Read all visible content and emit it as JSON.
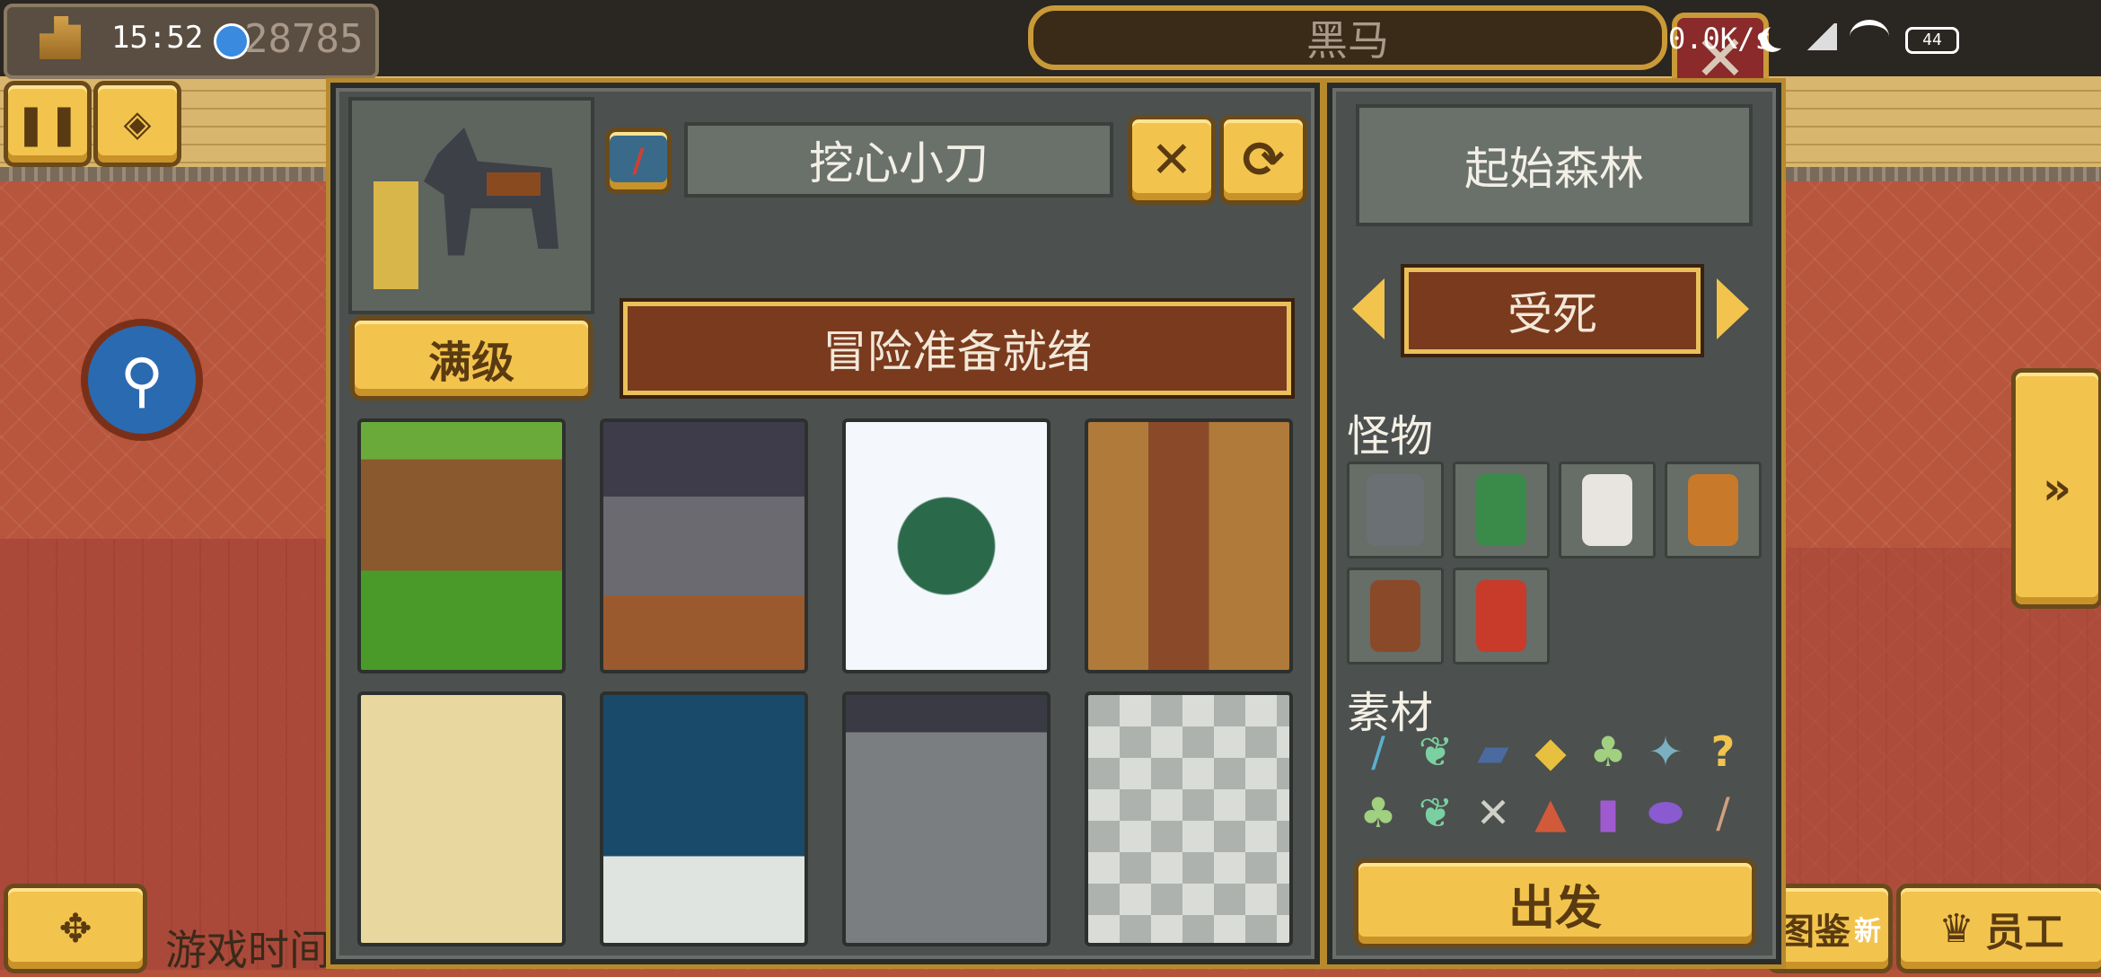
{
  "status_bar": {
    "time": "15:52",
    "coins": "28785",
    "net_speed": "0.0K/s",
    "battery": "44"
  },
  "window_title": "黑马",
  "left_panel": {
    "tool_name": "挖心小刀",
    "level_button": "满级",
    "ready_status": "冒险准备就绪"
  },
  "right_panel": {
    "location": "起始森林",
    "mode": "受死",
    "monsters_label": "怪物",
    "materials_label": "素材",
    "depart_button": "出发"
  },
  "bottom_right": {
    "staff_label": "员工",
    "catalog_label": "图鉴",
    "new_badge": "新"
  },
  "bottom_left": {
    "game_time_label": "游戏时间"
  },
  "colors": {
    "gold": "#f2c44e",
    "panel": "#4c504e",
    "brown": "#7a3a1e"
  }
}
